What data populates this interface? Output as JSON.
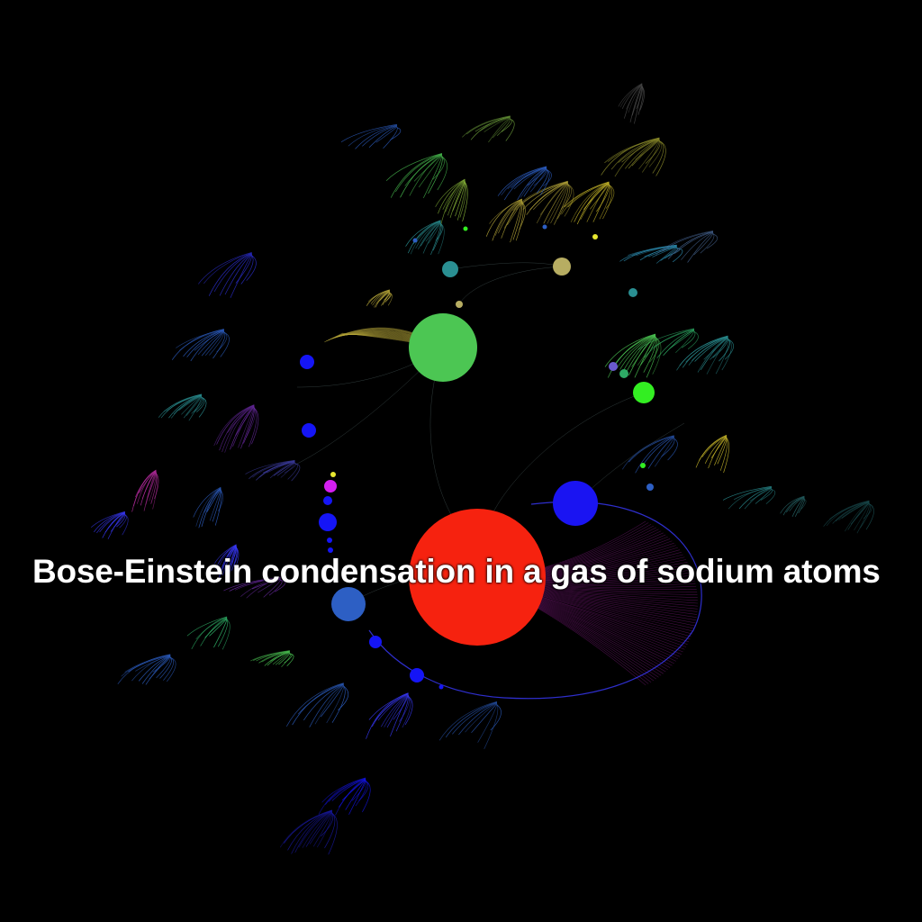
{
  "title": "Bose-Einstein condensation in a gas of sodium atoms",
  "palette": {
    "background": "#000000",
    "root": "#f6220f",
    "primary_green": "#4cc653",
    "blue": "#1515f6",
    "steel_blue": "#2d5fc4",
    "teal": "#2a8f92",
    "khaki": "#b7ad62",
    "lime": "#33ee22",
    "magenta": "#d41ff0",
    "purple_edge": "#6a1a6e",
    "yellow_edge": "#b8a83a"
  },
  "nodes": [
    {
      "id": "root",
      "color": "#f6220f"
    },
    {
      "id": "hub-green",
      "color": "#4cc653"
    },
    {
      "id": "hub-blue-right",
      "color": "#1a14f2"
    },
    {
      "id": "hub-steelblue-left",
      "color": "#2d5fc4"
    },
    {
      "id": "hub-lime",
      "color": "#33ee22"
    },
    {
      "id": "hub-khaki",
      "color": "#b7ad62"
    },
    {
      "id": "hub-teal",
      "color": "#2a8f92"
    },
    {
      "id": "hub-magenta",
      "color": "#d41ff0"
    }
  ]
}
